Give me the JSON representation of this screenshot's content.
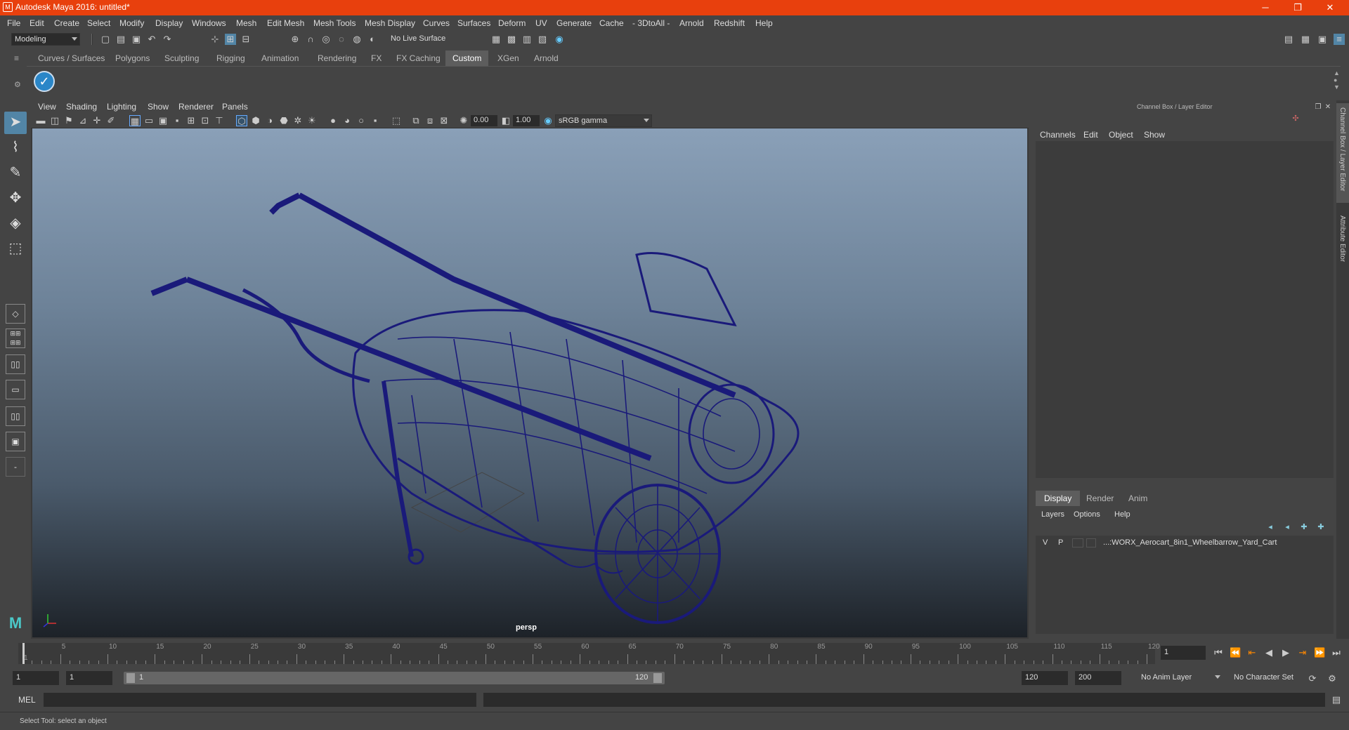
{
  "window": {
    "title": "Autodesk Maya 2016: untitled*",
    "minimize": "─",
    "maximize": "❐",
    "close": "✕"
  },
  "menubar": [
    "File",
    "Edit",
    "Create",
    "Select",
    "Modify",
    "Display",
    "Windows",
    "Mesh",
    "Edit Mesh",
    "Mesh Tools",
    "Mesh Display",
    "Curves",
    "Surfaces",
    "Deform",
    "UV",
    "Generate",
    "Cache",
    "- 3DtoAll -",
    "Arnold",
    "Redshift",
    "Help"
  ],
  "statusline": {
    "mode": "Modeling",
    "live_surface": "No Live Surface"
  },
  "shelf_tabs": [
    "Curves / Surfaces",
    "Polygons",
    "Sculpting",
    "Rigging",
    "Animation",
    "Rendering",
    "FX",
    "FX Caching",
    "Custom",
    "XGen",
    "Arnold"
  ],
  "shelf_active": "Custom",
  "viewport": {
    "menus": [
      "View",
      "Shading",
      "Lighting",
      "Show",
      "Renderer",
      "Panels"
    ],
    "exposure": "0.00",
    "gamma": "1.00",
    "color_space": "sRGB gamma",
    "camera_label": "persp"
  },
  "channel_box": {
    "title": "Channel Box / Layer Editor",
    "menus": [
      "Channels",
      "Edit",
      "Object",
      "Show"
    ],
    "layer_tabs": [
      "Display",
      "Render",
      "Anim"
    ],
    "layer_tab_active": "Display",
    "layer_menus": [
      "Layers",
      "Options",
      "Help"
    ],
    "layer_row": {
      "v": "V",
      "p": "P",
      "name": "...:WORX_Aerocart_8in1_Wheelbarrow_Yard_Cart"
    }
  },
  "side_tabs": {
    "channel_box": "Channel Box / Layer Editor",
    "attribute_editor": "Attribute Editor"
  },
  "timeline": {
    "ticks": [
      "1",
      "5",
      "10",
      "15",
      "20",
      "25",
      "30",
      "35",
      "40",
      "45",
      "50",
      "55",
      "60",
      "65",
      "70",
      "75",
      "80",
      "85",
      "90",
      "95",
      "100",
      "105",
      "110",
      "115",
      "120"
    ],
    "current_frame": "1"
  },
  "range": {
    "start": "1",
    "start2": "1",
    "slider_start": "1",
    "slider_end": "120",
    "end": "120",
    "end2": "200",
    "anim_layer": "No Anim Layer",
    "char_set": "No Character Set"
  },
  "command_line": {
    "label": "MEL"
  },
  "help_line": "Select Tool: select an object",
  "colors": {
    "title_bar": "#e8400d",
    "wire": "#1a1a7a",
    "active_tab": "#5d5d5d"
  }
}
